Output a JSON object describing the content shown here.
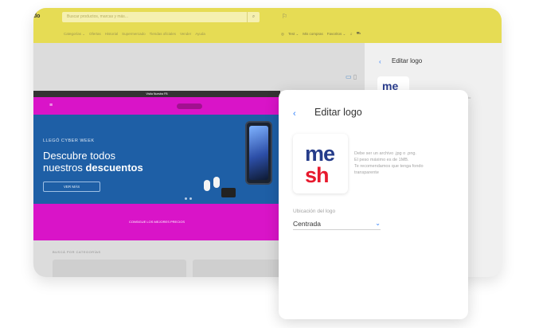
{
  "browser": {
    "logo_fragment": "ado",
    "search_placeholder": "Buscar productos, marcas y más...",
    "promo_icon": "promo-icon",
    "nav": [
      "Categorías ⌄",
      "Ofertas",
      "Historial",
      "Supermercado",
      "Tiendas oficiales",
      "Vender",
      "Ayuda"
    ],
    "user": {
      "name": "Test ⌄",
      "purchases": "Mis compras",
      "favorites": "Favoritos ⌄"
    }
  },
  "preview": {
    "top_strip": "Visita Nuestra FB",
    "hero_tag": "LLEGÓ CYBER WEEK",
    "hero_title_1": "Descubre todos",
    "hero_title_2a": "nuestros ",
    "hero_title_2b": "descuentos",
    "hero_button": "VER MÁS",
    "bar_text": "CONSIGUE LOS MEJORES PRECIOS",
    "category_label": "BUSCÁ POR CATEGORÍAS"
  },
  "side_panel": {
    "back": "‹",
    "title": "Editar logo",
    "help_lines": [
      "...ng",
      "...fondo"
    ],
    "logo_text": "me"
  },
  "modal": {
    "back": "‹",
    "title": "Editar logo",
    "logo_line1": "me",
    "logo_line2": "sh",
    "help_lines": [
      "Debe ser un archivo .jpg o .png.",
      "El peso máximo es de 1MB.",
      "Te recomendamos que tenga fondo",
      "transparente"
    ],
    "location_label": "Ubicación del logo",
    "location_value": "Centrada",
    "colors": {
      "accent": "#3483fa",
      "brand_yellow": "#e6dc54",
      "shop_magenta": "#d914c8",
      "logo_blue": "#253c8a",
      "logo_red": "#e7192d"
    }
  }
}
